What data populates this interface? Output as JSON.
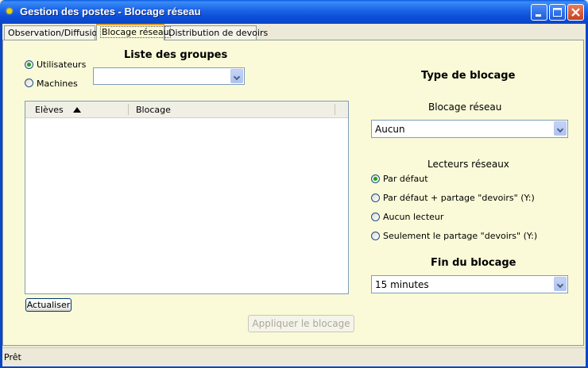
{
  "window": {
    "title": "Gestion des postes - Blocage réseau"
  },
  "tabs": [
    {
      "label": "Observation/Diffusion"
    },
    {
      "label": "Blocage réseau"
    },
    {
      "label": "Distribution de devoirs"
    }
  ],
  "left": {
    "target_options": [
      {
        "label": "Utilisateurs",
        "selected": true
      },
      {
        "label": "Machines",
        "selected": false
      }
    ],
    "groups_title": "Liste des groupes",
    "groups_value": "",
    "table": {
      "columns": [
        "Elèves",
        "Blocage"
      ],
      "sorted_column": "Elèves",
      "rows": []
    },
    "refresh_button": "Actualiser"
  },
  "right": {
    "title": "Type de blocage",
    "network_block_label": "Blocage réseau",
    "network_block_value": "Aucun",
    "drives_label": "Lecteurs réseaux",
    "drive_options": [
      {
        "label": "Par défaut",
        "selected": true
      },
      {
        "label": "Par défaut + partage \"devoirs\" (Y:)",
        "selected": false
      },
      {
        "label": "Aucun lecteur",
        "selected": false
      },
      {
        "label": "Seulement le partage \"devoirs\" (Y:)",
        "selected": false
      }
    ],
    "end_label": "Fin du blocage",
    "end_value": "15 minutes"
  },
  "apply_button": "Appliquer le blocage",
  "status": "Prêt",
  "colors": {
    "panel_bg": "#fafad8",
    "titlebar": "#0a46c8",
    "radio_on": "#21a121"
  }
}
